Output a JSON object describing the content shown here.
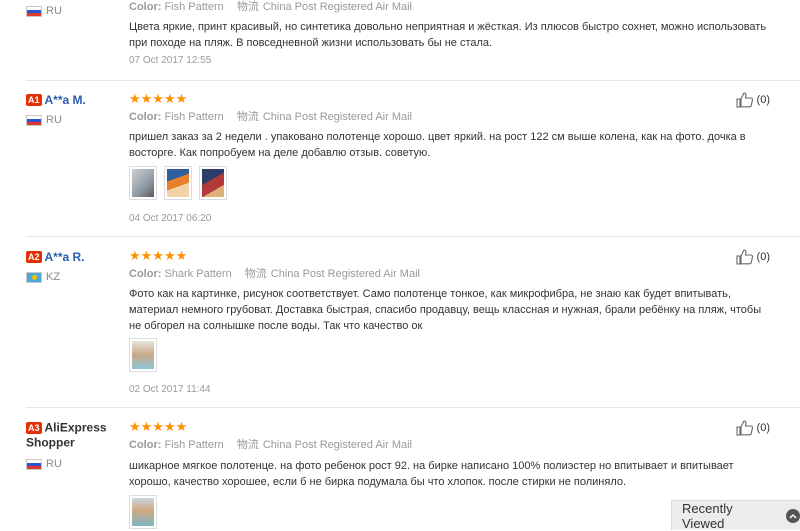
{
  "reviews": [
    {
      "country": "RU",
      "color_label": "Color:",
      "color_value": "Fish Pattern",
      "shipping": "China Post Registered Air Mail",
      "text": "Цвета яркие, принт красивый, но синтетика довольно неприятная и жёсткая. Из плюсов быстро сохнет, можно использовать при походе на пляж. В повседневной жизни использовать бы не стала.",
      "date": "07 Oct 2017 12:55"
    },
    {
      "rank": "A1",
      "name": "A**a M.",
      "country": "RU",
      "stars": "★★★★★",
      "color_label": "Color:",
      "color_value": "Fish Pattern",
      "shipping": "China Post Registered Air Mail",
      "text": "пришел заказ за 2 недели . упаковано полотенце хорошо. цвет яркий. на рост 122 см выше колена, как на фото. дочка в восторге. Как попробуем на деле добавлю отзыв. советую.",
      "date": "04 Oct 2017 06:20",
      "helpful": "(0)"
    },
    {
      "rank": "A2",
      "name": "A**a R.",
      "country": "KZ",
      "stars": "★★★★★",
      "color_label": "Color:",
      "color_value": "Shark Pattern",
      "shipping": "China Post Registered Air Mail",
      "text": "Фото как на картинке, рисунок соответствует. Само полотенце тонкое, как микрофибра, не знаю как будет впитывать, материал немного грубоват. Доставка быстрая, спасибо продавцу, вещь классная и нужная, брали ребёнку на пляж, чтобы не обгорел на солнышке после воды. Так что качество ок",
      "date": "02 Oct 2017 11:44",
      "helpful": "(0)"
    },
    {
      "rank": "A3",
      "name": "AliExpress Shopper",
      "country": "RU",
      "stars": "★★★★★",
      "color_label": "Color:",
      "color_value": "Fish Pattern",
      "shipping": "China Post Registered Air Mail",
      "text": "шикарное мягкое полотенце. на фото ребенок рост 92. на бирке написано 100% полиэстер но впитывает и впитывает хорошо, качество хорошее, если б не бирка подумала бы что хлопок. после стирки не полиняло.",
      "helpful": "(0)"
    }
  ],
  "shipping_icon": "物流",
  "recently_viewed": "Recently Viewed",
  "colors": {
    "accent_orange": "#ff9000",
    "badge_red": "#e62e04",
    "name_blue": "#2a5db0"
  }
}
